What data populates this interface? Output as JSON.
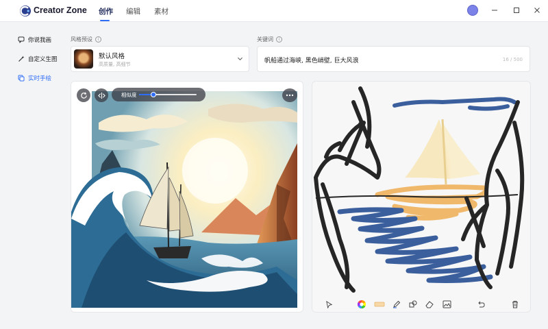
{
  "app": {
    "name": "Creator Zone"
  },
  "nav": {
    "tabs": [
      "创作",
      "编辑",
      "素材"
    ],
    "active": 0
  },
  "sidebar": {
    "items": [
      {
        "label": "你说我画",
        "icon": "chat-bubble-icon"
      },
      {
        "label": "自定义生图",
        "icon": "magic-wand-icon"
      },
      {
        "label": "实时手绘",
        "icon": "canvas-icon",
        "active": true
      }
    ]
  },
  "style_preset": {
    "label": "风格预设",
    "name": "默认风格",
    "description": "高质量, 高细节"
  },
  "keywords": {
    "label": "关键词",
    "value": "帆船通过海峡, 黑色峭壁, 巨大风浪",
    "counter": "16 / 500"
  },
  "similarity": {
    "label": "相似度",
    "value": 0.25
  },
  "colors": {
    "accent": "#2f6df6",
    "sketch_black": "#262626",
    "sketch_blue": "#3b5f9d",
    "sketch_orange": "#f0b86a",
    "sketch_cream": "#f5e3b0"
  },
  "toolbar": {
    "tools": [
      "pointer-icon",
      "color-wheel-icon",
      "brush-size-icon",
      "pen-icon",
      "shape-icon",
      "eraser-icon",
      "image-icon",
      "undo-icon",
      "delete-icon"
    ]
  }
}
